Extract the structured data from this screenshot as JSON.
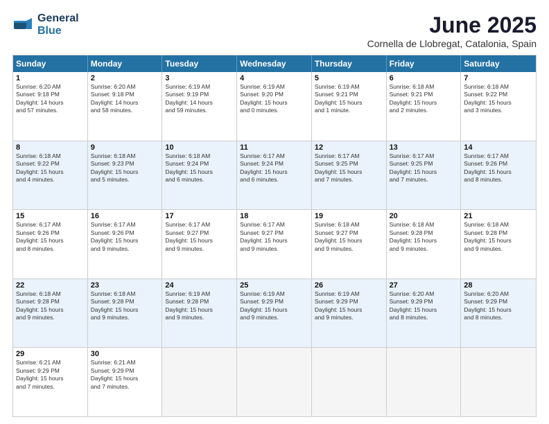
{
  "logo": {
    "line1": "General",
    "line2": "Blue"
  },
  "title": "June 2025",
  "location": "Cornella de Llobregat, Catalonia, Spain",
  "headers": [
    "Sunday",
    "Monday",
    "Tuesday",
    "Wednesday",
    "Thursday",
    "Friday",
    "Saturday"
  ],
  "rows": [
    [
      {
        "day": "",
        "empty": true
      },
      {
        "day": "",
        "empty": true
      },
      {
        "day": "",
        "empty": true
      },
      {
        "day": "",
        "empty": true
      },
      {
        "day": "",
        "empty": true
      },
      {
        "day": "",
        "empty": true
      },
      {
        "day": "",
        "empty": true
      }
    ],
    [
      {
        "day": "1",
        "text": "Sunrise: 6:20 AM\nSunset: 9:18 PM\nDaylight: 14 hours\nand 57 minutes."
      },
      {
        "day": "2",
        "text": "Sunrise: 6:20 AM\nSunset: 9:18 PM\nDaylight: 14 hours\nand 58 minutes."
      },
      {
        "day": "3",
        "text": "Sunrise: 6:19 AM\nSunset: 9:19 PM\nDaylight: 14 hours\nand 59 minutes."
      },
      {
        "day": "4",
        "text": "Sunrise: 6:19 AM\nSunset: 9:20 PM\nDaylight: 15 hours\nand 0 minutes."
      },
      {
        "day": "5",
        "text": "Sunrise: 6:19 AM\nSunset: 9:21 PM\nDaylight: 15 hours\nand 1 minute."
      },
      {
        "day": "6",
        "text": "Sunrise: 6:18 AM\nSunset: 9:21 PM\nDaylight: 15 hours\nand 2 minutes."
      },
      {
        "day": "7",
        "text": "Sunrise: 6:18 AM\nSunset: 9:22 PM\nDaylight: 15 hours\nand 3 minutes."
      }
    ],
    [
      {
        "day": "8",
        "text": "Sunrise: 6:18 AM\nSunset: 9:22 PM\nDaylight: 15 hours\nand 4 minutes."
      },
      {
        "day": "9",
        "text": "Sunrise: 6:18 AM\nSunset: 9:23 PM\nDaylight: 15 hours\nand 5 minutes."
      },
      {
        "day": "10",
        "text": "Sunrise: 6:18 AM\nSunset: 9:24 PM\nDaylight: 15 hours\nand 6 minutes."
      },
      {
        "day": "11",
        "text": "Sunrise: 6:17 AM\nSunset: 9:24 PM\nDaylight: 15 hours\nand 6 minutes."
      },
      {
        "day": "12",
        "text": "Sunrise: 6:17 AM\nSunset: 9:25 PM\nDaylight: 15 hours\nand 7 minutes."
      },
      {
        "day": "13",
        "text": "Sunrise: 6:17 AM\nSunset: 9:25 PM\nDaylight: 15 hours\nand 7 minutes."
      },
      {
        "day": "14",
        "text": "Sunrise: 6:17 AM\nSunset: 9:26 PM\nDaylight: 15 hours\nand 8 minutes."
      }
    ],
    [
      {
        "day": "15",
        "text": "Sunrise: 6:17 AM\nSunset: 9:26 PM\nDaylight: 15 hours\nand 8 minutes."
      },
      {
        "day": "16",
        "text": "Sunrise: 6:17 AM\nSunset: 9:26 PM\nDaylight: 15 hours\nand 9 minutes."
      },
      {
        "day": "17",
        "text": "Sunrise: 6:17 AM\nSunset: 9:27 PM\nDaylight: 15 hours\nand 9 minutes."
      },
      {
        "day": "18",
        "text": "Sunrise: 6:17 AM\nSunset: 9:27 PM\nDaylight: 15 hours\nand 9 minutes."
      },
      {
        "day": "19",
        "text": "Sunrise: 6:18 AM\nSunset: 9:27 PM\nDaylight: 15 hours\nand 9 minutes."
      },
      {
        "day": "20",
        "text": "Sunrise: 6:18 AM\nSunset: 9:28 PM\nDaylight: 15 hours\nand 9 minutes."
      },
      {
        "day": "21",
        "text": "Sunrise: 6:18 AM\nSunset: 9:28 PM\nDaylight: 15 hours\nand 9 minutes."
      }
    ],
    [
      {
        "day": "22",
        "text": "Sunrise: 6:18 AM\nSunset: 9:28 PM\nDaylight: 15 hours\nand 9 minutes."
      },
      {
        "day": "23",
        "text": "Sunrise: 6:18 AM\nSunset: 9:28 PM\nDaylight: 15 hours\nand 9 minutes."
      },
      {
        "day": "24",
        "text": "Sunrise: 6:19 AM\nSunset: 9:28 PM\nDaylight: 15 hours\nand 9 minutes."
      },
      {
        "day": "25",
        "text": "Sunrise: 6:19 AM\nSunset: 9:29 PM\nDaylight: 15 hours\nand 9 minutes."
      },
      {
        "day": "26",
        "text": "Sunrise: 6:19 AM\nSunset: 9:29 PM\nDaylight: 15 hours\nand 9 minutes."
      },
      {
        "day": "27",
        "text": "Sunrise: 6:20 AM\nSunset: 9:29 PM\nDaylight: 15 hours\nand 8 minutes."
      },
      {
        "day": "28",
        "text": "Sunrise: 6:20 AM\nSunset: 9:29 PM\nDaylight: 15 hours\nand 8 minutes."
      }
    ],
    [
      {
        "day": "29",
        "text": "Sunrise: 6:21 AM\nSunset: 9:29 PM\nDaylight: 15 hours\nand 7 minutes."
      },
      {
        "day": "30",
        "text": "Sunrise: 6:21 AM\nSunset: 9:29 PM\nDaylight: 15 hours\nand 7 minutes."
      },
      {
        "day": "",
        "empty": true
      },
      {
        "day": "",
        "empty": true
      },
      {
        "day": "",
        "empty": true
      },
      {
        "day": "",
        "empty": true
      },
      {
        "day": "",
        "empty": true
      }
    ]
  ]
}
